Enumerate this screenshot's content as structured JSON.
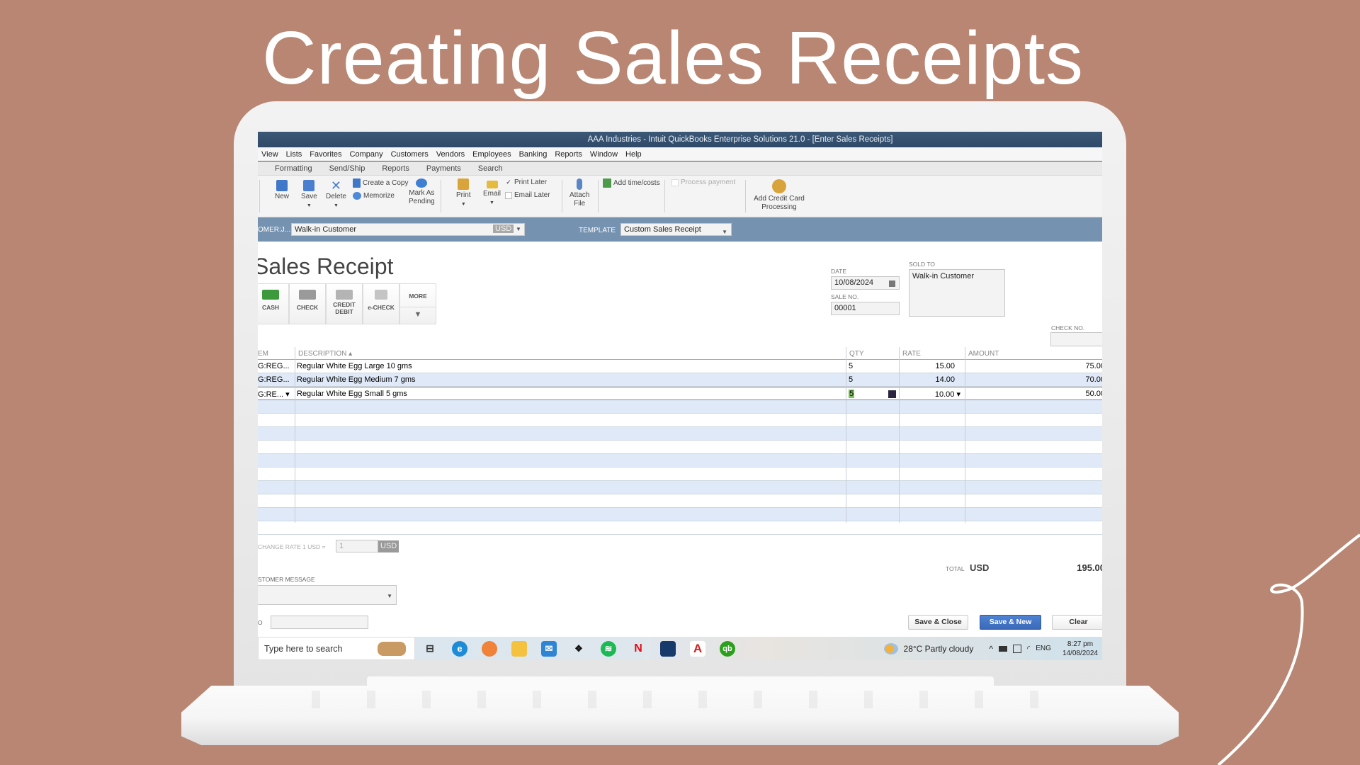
{
  "slide": {
    "title": "Creating Sales Receipts",
    "background": "#B88672"
  },
  "window": {
    "title": "AAA Industries  - Intuit QuickBooks Enterprise Solutions 21.0 - [Enter Sales Receipts]"
  },
  "menu": [
    "View",
    "Lists",
    "Favorites",
    "Company",
    "Customers",
    "Vendors",
    "Employees",
    "Banking",
    "Reports",
    "Window",
    "Help"
  ],
  "tabs": [
    "Formatting",
    "Send/Ship",
    "Reports",
    "Payments",
    "Search"
  ],
  "toolbar": {
    "new": "New",
    "save": "Save",
    "delete": "Delete",
    "create_copy": "Create a Copy",
    "memorize": "Memorize",
    "mark_pending_1": "Mark As",
    "mark_pending_2": "Pending",
    "print": "Print",
    "email": "Email",
    "print_later": "Print Later",
    "print_later_checked": true,
    "email_later": "Email Later",
    "email_later_checked": false,
    "attach_1": "Attach",
    "attach_2": "File",
    "add_time_costs": "Add time/costs",
    "process_payment": "Process payment",
    "add_cc_1": "Add Credit Card",
    "add_cc_2": "Processing"
  },
  "customer_bar": {
    "customer_label": "OMER:J...",
    "customer_value": "Walk-in Customer",
    "currency": "USD",
    "template_label": "TEMPLATE",
    "template_value": "Custom Sales Receipt"
  },
  "form": {
    "title": "Sales Receipt",
    "payment_methods": [
      {
        "label": "CASH"
      },
      {
        "label": "CHECK"
      },
      {
        "label": "CREDIT\nDEBIT",
        "l1": "CREDIT",
        "l2": "DEBIT"
      },
      {
        "label": "e-CHECK"
      },
      {
        "label": "MORE"
      }
    ],
    "date_label": "DATE",
    "date_value": "10/08/2024",
    "sale_no_label": "SALE NO.",
    "sale_no_value": "00001",
    "sold_to_label": "SOLD TO",
    "sold_to_value": "Walk-in Customer",
    "check_no_label": "CHECK NO.",
    "check_no_value": ""
  },
  "grid": {
    "headers": {
      "item": "EM",
      "description": "DESCRIPTION ▴",
      "qty": "QTY",
      "rate": "RATE",
      "amount": "AMOUNT"
    },
    "rows": [
      {
        "item": "G:REG...",
        "description": "Regular White Egg Large 10 gms",
        "qty": "5",
        "rate": "15.00",
        "amount": "75.00"
      },
      {
        "item": "G:REG...",
        "description": "Regular White Egg Medium 7 gms",
        "qty": "5",
        "rate": "14.00",
        "amount": "70.00"
      },
      {
        "item": "G:RE... ▾",
        "description": "Regular White Egg Small 5 gms",
        "qty": "5",
        "rate": "10.00 ▾",
        "amount": "50.00"
      }
    ]
  },
  "footer": {
    "exchange_label": "CHANGE RATE 1 USD =",
    "exchange_value": "1",
    "exchange_currency": "USD",
    "customer_message_label": "STOMER MESSAGE",
    "memo_label": "O",
    "total_label": "TOTAL",
    "total_currency": "USD",
    "total_value": "195.00",
    "save_close": "Save & Close",
    "save_new": "Save & New",
    "clear": "Clear"
  },
  "taskbar": {
    "search_placeholder": "Type here to search",
    "apps": [
      "task-view",
      "edge",
      "firefox",
      "file-explorer",
      "mail",
      "dropbox",
      "spotify",
      "netflix",
      "app-blue",
      "acrobat",
      "quickbooks"
    ],
    "weather": "28°C  Partly cloudy",
    "language": "ENG",
    "time": "8:27 pm",
    "date": "14/08/2024"
  }
}
